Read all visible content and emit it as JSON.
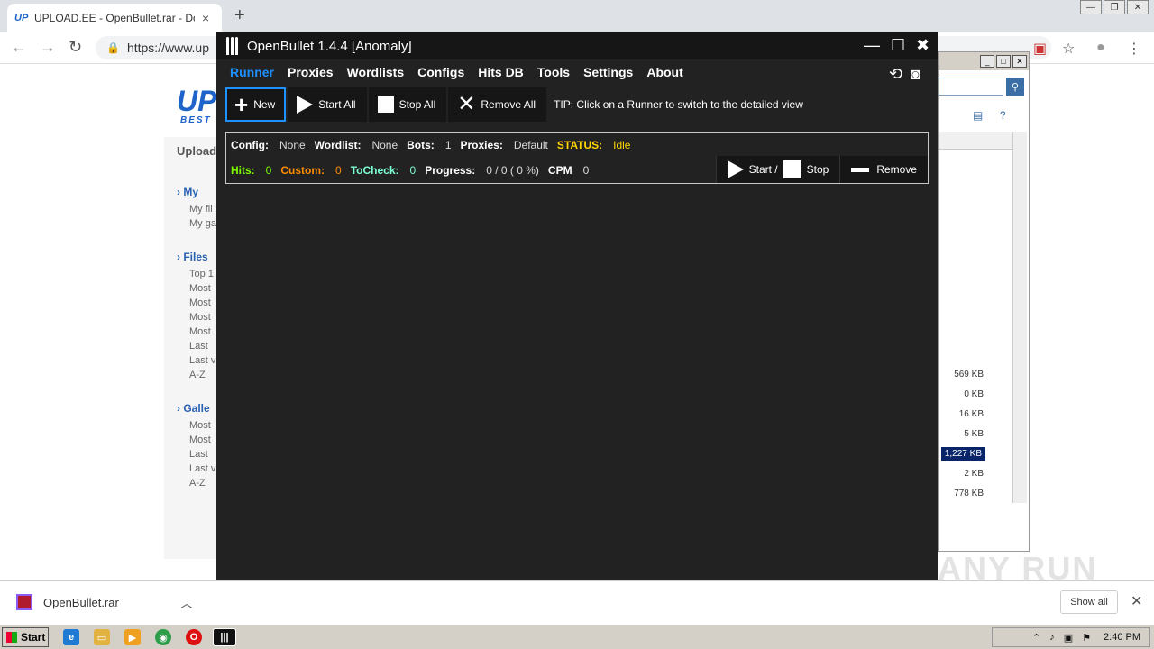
{
  "browser": {
    "tab_favicon": "UP",
    "tab_title": "UPLOAD.EE - OpenBullet.rar - Download",
    "tab_close": "×",
    "new_tab": "+",
    "url": "https://www.up",
    "win_min": "—",
    "win_max": "❐",
    "win_close": "✕"
  },
  "site": {
    "logo": "UP",
    "logo_sub": "BEST",
    "upload": "Upload",
    "sections": [
      {
        "title": "My",
        "items": [
          "My fil",
          "My ga"
        ]
      },
      {
        "title": "Files",
        "items": [
          "Top 1",
          "Most",
          "Most",
          "Most",
          "Most",
          "Last",
          "Last v",
          "A-Z"
        ]
      },
      {
        "title": "Galle",
        "items": [
          "Most",
          "Most",
          "Last",
          "Last v",
          "A-Z"
        ]
      }
    ]
  },
  "bg_window": {
    "sizes": [
      "569 KB",
      "0 KB",
      "16 KB",
      "5 KB",
      "1,227 KB",
      "2 KB",
      "778 KB"
    ]
  },
  "openbullet": {
    "title": "OpenBullet 1.4.4 [Anomaly]",
    "menu": [
      "Runner",
      "Proxies",
      "Wordlists",
      "Configs",
      "Hits DB",
      "Tools",
      "Settings",
      "About"
    ],
    "buttons": {
      "new": "New",
      "start_all": "Start All",
      "stop_all": "Stop All",
      "remove_all": "Remove All"
    },
    "tip": "TIP: Click on a Runner to switch to the detailed view",
    "runner": {
      "config_label": "Config:",
      "config": "None",
      "wordlist_label": "Wordlist:",
      "wordlist": "None",
      "bots_label": "Bots:",
      "bots": "1",
      "proxies_label": "Proxies:",
      "proxies": "Default",
      "status_label": "STATUS:",
      "status": "Idle",
      "hits_label": "Hits:",
      "hits": "0",
      "custom_label": "Custom:",
      "custom": "0",
      "tocheck_label": "ToCheck:",
      "tocheck": "0",
      "progress_label": "Progress:",
      "progress": "0 / 0 ( 0 %)",
      "cpm_label": "CPM",
      "cpm": "0",
      "start_label": "Start /",
      "stop_label": "Stop",
      "remove_label": "Remove"
    }
  },
  "downloads": {
    "file": "OpenBullet.rar",
    "show_all": "Show all"
  },
  "taskbar": {
    "start": "Start",
    "clock": "2:40 PM"
  },
  "watermark": "ANY RUN",
  "colors": {
    "accent": "#1e90ff",
    "status": "#ffd700",
    "hits": "#7cfc00",
    "custom": "#ff8c00",
    "tocheck": "#7fffd4"
  }
}
